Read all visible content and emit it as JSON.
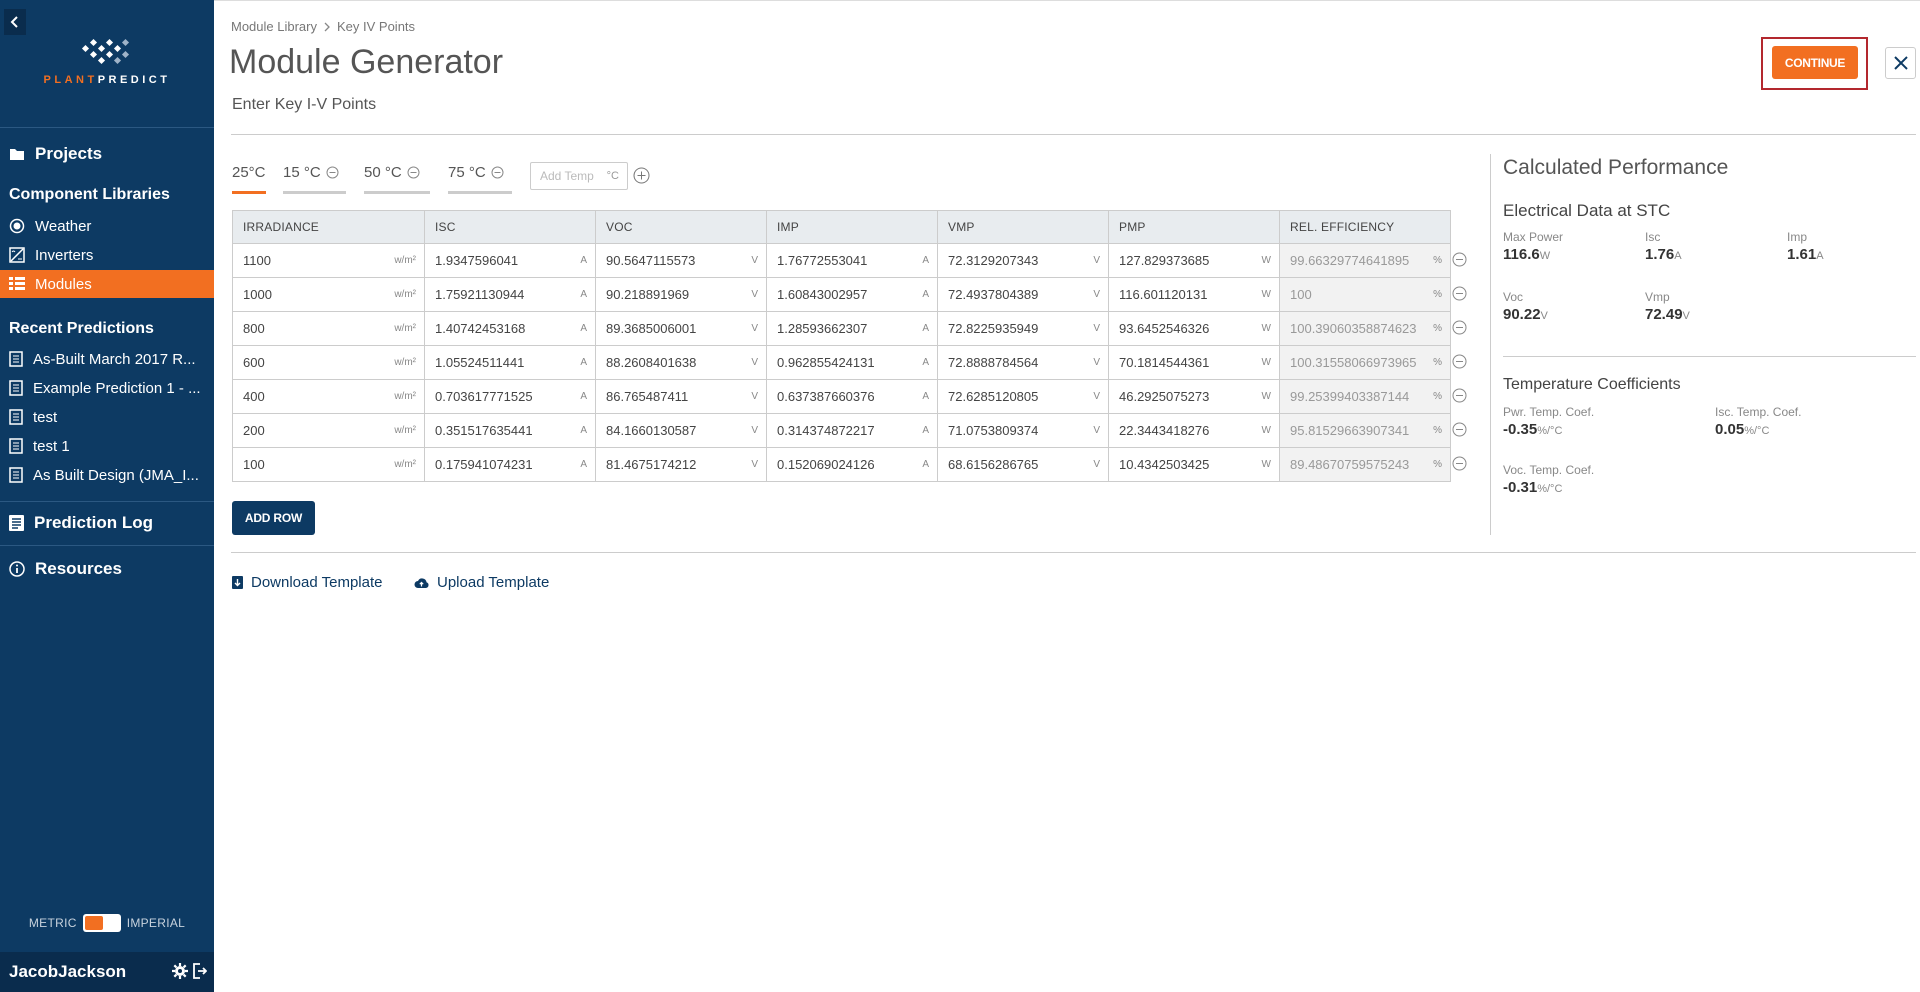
{
  "brand": {
    "name_part1": "PLANT",
    "name_part2": "PREDICT"
  },
  "colors": {
    "sidebar": "#0d3a63",
    "accent": "#f26f21"
  },
  "nav": {
    "projects": "Projects",
    "component_libraries": "Component Libraries",
    "libraries": [
      {
        "label": "Weather",
        "icon": "sun-icon"
      },
      {
        "label": "Inverters",
        "icon": "inverter-icon"
      },
      {
        "label": "Modules",
        "icon": "grid-icon",
        "active": true
      }
    ],
    "recent_predictions_title": "Recent Predictions",
    "recent": [
      {
        "label": "As-Built March 2017 R..."
      },
      {
        "label": "Example Prediction 1 - ..."
      },
      {
        "label": "test"
      },
      {
        "label": "test 1"
      },
      {
        "label": "As Built Design (JMA_I..."
      }
    ],
    "prediction_log": "Prediction Log",
    "resources": "Resources"
  },
  "units": {
    "metric": "METRIC",
    "imperial": "IMPERIAL"
  },
  "user": {
    "name": "JacobJackson"
  },
  "breadcrumb": {
    "parent": "Module Library",
    "current": "Key IV Points"
  },
  "header": {
    "title": "Module Generator",
    "subtitle": "Enter Key I-V Points",
    "continue": "CONTINUE"
  },
  "temps": {
    "tabs": [
      "25°C",
      "15 °C",
      "50 °C",
      "75 °C"
    ],
    "add_placeholder": "Add Temp",
    "add_unit": "°C"
  },
  "table": {
    "headers": [
      "IRRADIANCE",
      "ISC",
      "VOC",
      "IMP",
      "VMP",
      "PMP",
      "REL. EFFICIENCY"
    ],
    "units": [
      "w/m²",
      "A",
      "V",
      "A",
      "V",
      "W",
      "%"
    ],
    "rows": [
      [
        "1100",
        "1.9347596041",
        "90.5647115573",
        "1.76772553041",
        "72.3129207343",
        "127.829373685",
        "99.66329774641895"
      ],
      [
        "1000",
        "1.75921130944",
        "90.218891969",
        "1.60843002957",
        "72.4937804389",
        "116.601120131",
        "100"
      ],
      [
        "800",
        "1.40742453168",
        "89.3685006001",
        "1.28593662307",
        "72.8225935949",
        "93.6452546326",
        "100.39060358874623"
      ],
      [
        "600",
        "1.05524511441",
        "88.2608401638",
        "0.962855424131",
        "72.8888784564",
        "70.1814544361",
        "100.31558066973965"
      ],
      [
        "400",
        "0.703617771525",
        "86.765487411",
        "0.637387660376",
        "72.6285120805",
        "46.2925075273",
        "99.25399403387144"
      ],
      [
        "200",
        "0.351517635441",
        "84.1660130587",
        "0.314374872217",
        "71.0753809374",
        "22.3443418276",
        "95.81529663907341"
      ],
      [
        "100",
        "0.175941074231",
        "81.4675174212",
        "0.152069024126",
        "68.6156286765",
        "10.4342503425",
        "89.48670759575243"
      ]
    ],
    "add_row": "ADD ROW"
  },
  "templates": {
    "download": "Download Template",
    "upload": "Upload Template"
  },
  "performance": {
    "title": "Calculated Performance",
    "electrical_title": "Electrical Data at STC",
    "electrical": [
      {
        "label": "Max Power",
        "value": "116.6",
        "unit": "W"
      },
      {
        "label": "Isc",
        "value": "1.76",
        "unit": "A"
      },
      {
        "label": "Imp",
        "value": "1.61",
        "unit": "A"
      },
      {
        "label": "Voc",
        "value": "90.22",
        "unit": "V"
      },
      {
        "label": "Vmp",
        "value": "72.49",
        "unit": "V"
      }
    ],
    "temp_title": "Temperature Coefficients",
    "coefficients": [
      {
        "label": "Pwr. Temp. Coef.",
        "value": "-0.35",
        "unit": "%/°C"
      },
      {
        "label": "Isc. Temp. Coef.",
        "value": "0.05",
        "unit": "%/°C"
      },
      {
        "label": "Voc. Temp. Coef.",
        "value": "-0.31",
        "unit": "%/°C"
      }
    ]
  }
}
